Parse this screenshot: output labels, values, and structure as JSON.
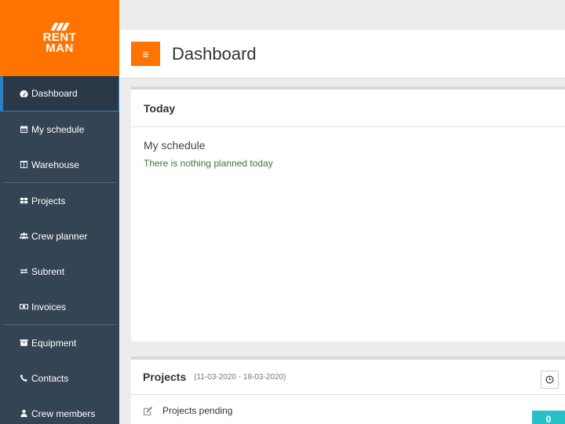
{
  "brand": {
    "line1": "RENT",
    "line2": "MAN",
    "color": "#ff7400"
  },
  "sidebar": {
    "items": [
      {
        "label": "Dashboard",
        "icon": "dashboard-icon",
        "active": true
      },
      {
        "label": "My schedule",
        "icon": "calendar-icon"
      },
      {
        "label": "Warehouse",
        "icon": "columns-icon"
      },
      {
        "label": "Projects",
        "icon": "grid-icon"
      },
      {
        "label": "Crew planner",
        "icon": "users-icon"
      },
      {
        "label": "Subrent",
        "icon": "exchange-icon"
      },
      {
        "label": "Invoices",
        "icon": "money-icon"
      },
      {
        "label": "Equipment",
        "icon": "archive-icon"
      },
      {
        "label": "Contacts",
        "icon": "phone-icon"
      },
      {
        "label": "Crew members",
        "icon": "user-icon"
      }
    ]
  },
  "header": {
    "menu_icon": "≡",
    "title": "Dashboard"
  },
  "today": {
    "title": "Today",
    "schedule_title": "My schedule",
    "empty_text": "There is nothing planned today"
  },
  "projects": {
    "title": "Projects",
    "date_range": "(11-03-2020 - 18-03-2020)",
    "rows": [
      {
        "label": "Projects pending",
        "count": "0"
      }
    ]
  },
  "colors": {
    "sidebar": "#354454",
    "accent": "#ff7400",
    "badge": "#26c0c8",
    "success_text": "#3c763d"
  }
}
